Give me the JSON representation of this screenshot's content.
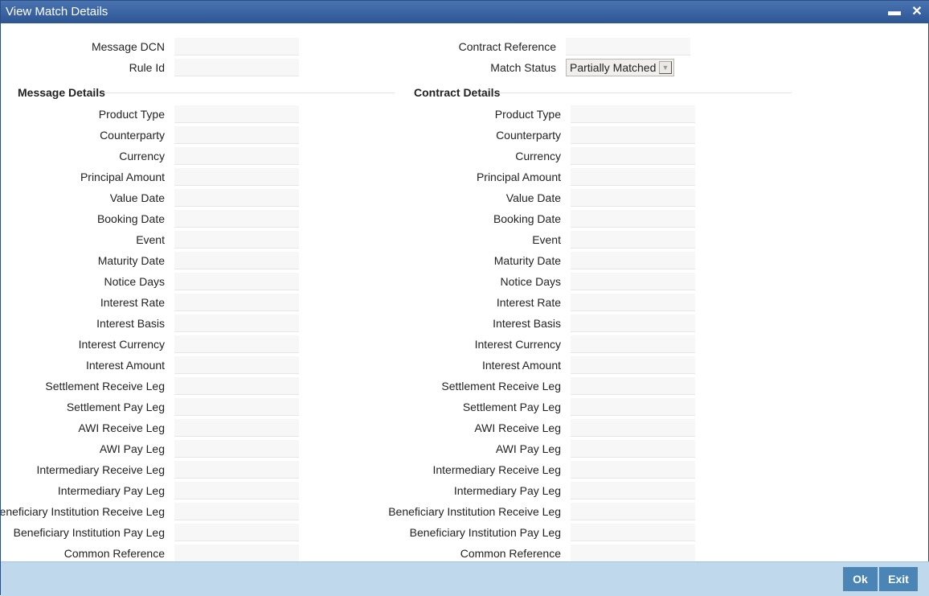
{
  "window": {
    "title": "View Match Details",
    "minimize_icon": "minimize-icon",
    "close_icon": "close-icon"
  },
  "header": {
    "message_dcn_label": "Message DCN",
    "message_dcn_value": "",
    "rule_id_label": "Rule Id",
    "rule_id_value": "",
    "contract_reference_label": "Contract Reference",
    "contract_reference_value": "",
    "match_status_label": "Match Status",
    "match_status_value": "Partially Matched"
  },
  "message_details": {
    "title": "Message Details"
  },
  "contract_details": {
    "title": "Contract Details"
  },
  "fields": [
    "Product Type",
    "Counterparty",
    "Currency",
    "Principal Amount",
    "Value Date",
    "Booking Date",
    "Event",
    "Maturity Date",
    "Notice Days",
    "Interest Rate",
    "Interest Basis",
    "Interest Currency",
    "Interest Amount",
    "Settlement Receive Leg",
    "Settlement Pay Leg",
    "AWI Receive Leg",
    "AWI Pay Leg",
    "Intermediary Receive Leg",
    "Intermediary Pay Leg",
    "Beneficiary Institution Receive Leg",
    "Beneficiary Institution Pay Leg",
    "Common Reference"
  ],
  "footer": {
    "ok_label": "Ok",
    "exit_label": "Exit"
  }
}
